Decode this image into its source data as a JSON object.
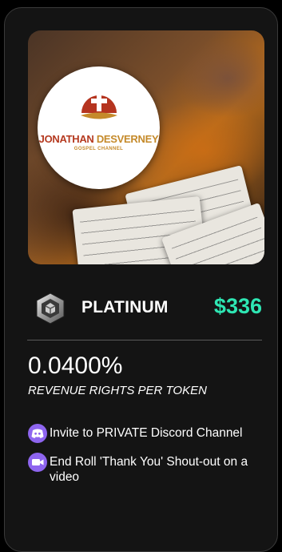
{
  "cover": {
    "logo_title_main": "JONATHAN",
    "logo_title_rest": " DESVERNEY",
    "logo_subtitle": "GOSPEL CHANNEL"
  },
  "tier": {
    "name": "PLATINUM",
    "price": "$336",
    "icon": "platinum-tier-icon",
    "price_color": "#2ee6b3"
  },
  "rights": {
    "percentage": "0.0400%",
    "label": "REVENUE RIGHTS PER TOKEN"
  },
  "perks": [
    {
      "icon": "discord-icon",
      "text": "Invite to PRIVATE Discord Channel"
    },
    {
      "icon": "video-camera-icon",
      "text": "End Roll 'Thank You' Shout-out on a video"
    }
  ],
  "colors": {
    "accent": "#2ee6b3",
    "perk_icon_bg": "#8e65ef",
    "card_bg": "#141414"
  }
}
